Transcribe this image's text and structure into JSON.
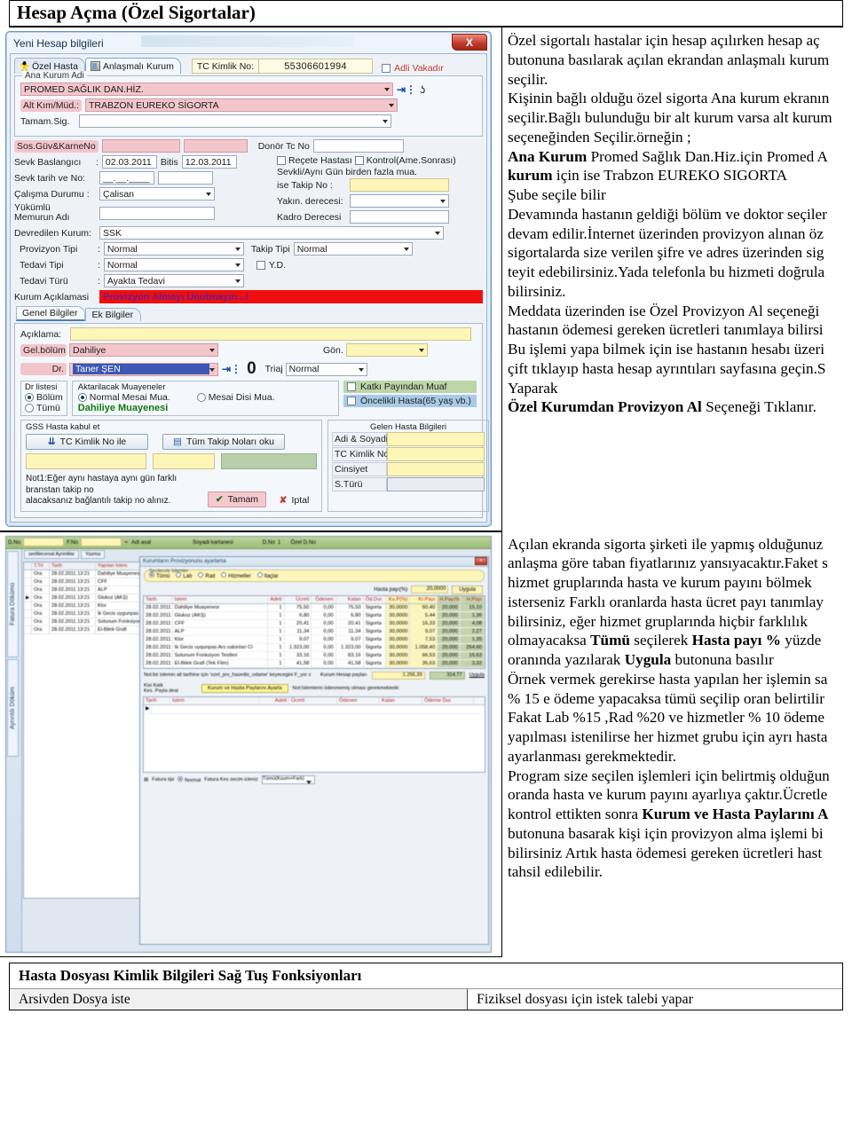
{
  "page": {
    "heading": "Hesap Açma (Özel Sigortalar)"
  },
  "dialog1": {
    "title": "Yeni Hesap bilgileri",
    "close_label": "X",
    "tabs": [
      {
        "label": "Özel Hasta",
        "icon": "person-icon",
        "active": false
      },
      {
        "label": "Anlaşmalı Kurum",
        "icon": "building-icon",
        "active": true
      }
    ],
    "tc_label": "TC Kimlik No:",
    "tc_value": "55306601994",
    "adli_label": "Adli Vakadır",
    "group_kurum": {
      "title": "Ana Kurum Adi",
      "ana_kurum_value": "PROMED SAĞLIK DAN.HİZ.",
      "alt_label": "Alt Kım/Müd.:",
      "alt_value": "TRABZON EUREKO SİGORTA",
      "tamam_label": "Tamam.Sig.",
      "tamam_value": ""
    },
    "sos_guv_label": "Sos.Güv&KarneNo",
    "donor_label": "Donör Tc No",
    "donor_value": "",
    "sevk_baslangici_label": "Sevk Baslangıcı",
    "sevk_baslangici_value": "02.03.2011",
    "bitis_label": "Bitis",
    "bitis_value": "12.03.2011",
    "recete_hastasi_label": "Reçete Hastası",
    "kontrol_label": "Kontrol(Ame.Sonrası)",
    "sevkli_note": "Sevkli/Aynı Gün birden fazla mua.",
    "ise_takip_label": "ise Takip No    :",
    "ise_takip_value": "",
    "sevk_tarih_label": "Sevk tarih ve No:",
    "sevk_tarih_value": "__.__.____",
    "calisma_label": "Çalışma Durumu :",
    "calisma_value": "Çalisan",
    "yakin_label": "Yakın. derecesi:",
    "yakin_value": "",
    "yukumlu_label": "Yükümlü\nMemurun Adı",
    "yukumlu_l1": "Yükümlü",
    "yukumlu_l2": "Memurun Adı",
    "yukumlu_value": "",
    "kadro_label": "Kadro Derecesi",
    "kadro_value": "",
    "devredilen_label": "Devredilen Kurum:",
    "devredilen_value": "SSK",
    "provizyon_tipi_label": "Provizyon Tipi",
    "provizyon_tipi_value": "Normal",
    "takip_tipi_label": "Takip Tipi",
    "takip_tipi_value": "Normal",
    "tedavi_tipi_label": "Tedavi Tipi",
    "tedavi_tipi_value": "Normal",
    "yd_label": "Y.D.",
    "tedavi_turu_label": "Tedavi Türü",
    "tedavi_turu_value": "Ayakta Tedavi",
    "kurum_aciklamasi_label": "Kurum Açıklamasi",
    "kurum_aciklamasi_value": "Provizyon Almayı Unutmayın...!",
    "subtabs": [
      {
        "label": "Genel Bilgiler",
        "active": true
      },
      {
        "label": "Ek Bilgiler",
        "active": false
      }
    ],
    "aciklama_label": "Açıklama:",
    "aciklama_value": "",
    "gel_bolum_label": "Gel.bölüm",
    "gel_bolum_value": "Dahiliye",
    "gon_label": "Gön.",
    "gon_value": "",
    "dr_label": "Dr.",
    "dr_value": "Taner ŞEN",
    "triaj_label": "Triaj",
    "triaj_value": "Normal",
    "counter_value": "0",
    "dr_listesi_title": "Dr listesi",
    "dr_listesi_options": [
      "Bölüm",
      "Tümü"
    ],
    "aktarilacak_title": "Aktarilacak Muayeneler",
    "normal_mesai_label": "Normal Mesai Mua.",
    "mesai_disi_label": "Mesai Disi Mua.",
    "dahiliye_muayenesi": "Dahiliye Muayenesi",
    "katki_label": "Katkı Payından Muaf",
    "oncelikli_label": "Öncelikli Hasta(65 yaş vb.)",
    "gss_title": "GSS Hasta kabul et",
    "tc_kimlik_btn": "TC Kimlik No ile",
    "tum_takip_btn": "Tüm Takip Noları oku",
    "gelen_hasta_title": "Gelen Hasta Bilgileri",
    "gelen_fields": [
      {
        "label": "Adi & Soyadi",
        "value": ""
      },
      {
        "label": "TC Kimlik No",
        "value": ""
      },
      {
        "label": "Cinsiyet",
        "value": ""
      },
      {
        "label": "S.Türü",
        "value": ""
      }
    ],
    "not1_l1": "Not1:Eğer aynı hastaya aynı gün farklı branstan takip no",
    "not1_l2": "alacaksanız bağlantılı takip no alınız.",
    "tamam_btn": "Tamam",
    "iptal_btn": "Iptal"
  },
  "text1": {
    "lines": [
      {
        "text": "Özel sigortalı hastalar için hesap açılırken hesap aç",
        "bold": false
      },
      {
        "text": "butonuna basılarak açılan ekrandan anlaşmalı kurum",
        "bold": false
      },
      {
        "text": "seçilir.",
        "bold": false
      },
      {
        "text": "Kişinin bağlı olduğu özel sigorta Ana kurum ekranın",
        "bold": false
      },
      {
        "text": "seçilir.Bağlı bulunduğu bir alt kurum varsa alt kurum",
        "bold": false
      },
      {
        "text": "seçeneğinden Seçilir.örneğin ;",
        "bold": false
      },
      {
        "text": "Ana Kurum  Promed Sağlık Dan.Hiz.için Promed A",
        "bold": "partial1"
      },
      {
        "text": "kurum için ise Trabzon EUREKO SIGORTA",
        "bold": "partial2"
      },
      {
        "text": " Şube  seçile bilir",
        "bold": false
      },
      {
        "text": "Devamında hastanın geldiği bölüm ve doktor seçiler",
        "bold": false
      },
      {
        "text": "devam edilir.İnternet üzerinden provizyon alınan öz",
        "bold": false
      },
      {
        "text": "sigortalarda size verilen şifre ve adres üzerinden sig",
        "bold": false
      },
      {
        "text": "teyit edebilirsiniz.Yada telefonla bu hizmeti doğrula",
        "bold": false
      },
      {
        "text": "bilirsiniz.",
        "bold": false
      },
      {
        "text": "Meddata üzerinden ise Özel Provizyon Al seçeneği",
        "bold": false
      },
      {
        "text": "hastanın ödemesi gereken ücretleri tanımlaya bilirsi",
        "bold": false
      },
      {
        "text": "Bu işlemi yapa bilmek için ise hastanın hesabı üzeri",
        "bold": false
      },
      {
        "text": "çift tıklayıp hasta hesap ayrıntıları sayfasına geçin.S",
        "bold": false
      },
      {
        "text": "Yaparak",
        "bold": false
      },
      {
        "text": "Özel Kurumdan Provizyon Al Seçeneği Tıklanır.",
        "bold": "partial3"
      }
    ],
    "l7_bold": "Ana Kurum",
    "l7_rest": " Promed Sağlık Dan.Hiz.için Promed A",
    "l8_bold": "kurum",
    "l8_rest": " için ise Trabzon EUREKO SIGORTA",
    "l20_bold": "Özel Kurumdan Provizyon Al",
    "l20_rest": " Seçeneği Tıklanır."
  },
  "dialog2": {
    "topbar_fields": [
      {
        "label": "D.No",
        "value": ""
      },
      {
        "label": "F.No",
        "value": ""
      },
      {
        "label": "Adi asal",
        "value": ""
      },
      {
        "label": "Soyadi kartanesi",
        "value": ""
      },
      {
        "label": "D.No",
        "value": "1"
      },
      {
        "label": "Özel D.No",
        "value": ""
      }
    ],
    "vertical_tabs": [
      "Fatura Dökümü",
      "Ayrıntılı Döküm"
    ],
    "left_tabs": [
      "serilliecenal Ayrintilar",
      "Yazma"
    ],
    "left_grid_headers": [
      "",
      "T.Tri",
      "Tarih",
      "Yapılan Islem"
    ],
    "left_grid_rows": [
      {
        "c0": "Ora",
        "c1": "28.02.2011 13:21",
        "c2": "Dahiliye Muayenesi"
      },
      {
        "c0": "Ora",
        "c1": "28.02.2011 13:21",
        "c2": "CFF"
      },
      {
        "c0": "Ora",
        "c1": "28.02.2011 13:21",
        "c2": "ALP"
      },
      {
        "c0": "Ora",
        "c1": "28.02.2011 13:21",
        "c2": "Glukoz (AKŞ)"
      },
      {
        "c0": "Ora",
        "c1": "28.02.2011 13:21",
        "c2": "Klor"
      },
      {
        "c0": "Ora",
        "c1": "28.02.2011 13:21",
        "c2": "Ik Gecis uygunpas"
      },
      {
        "c0": "Ora",
        "c1": "28.02.2011 13:21",
        "c2": "Solunum Fonksiyon"
      },
      {
        "c0": "Ora",
        "c1": "28.02.2011 13:21",
        "c2": "El-Bilek Grafi"
      }
    ],
    "inner_title": "Kurumların Provizyonunu ayarlama",
    "inner_close": "x",
    "secilecek_label": "Secilecek Islemler",
    "secilecek_options": [
      "Tümü",
      "Lab",
      "Rad",
      "Hizmetler",
      "Ilaçlar"
    ],
    "secilecek_selected": "Tümü",
    "hasta_payi_label": "Hasta payı(%)",
    "hasta_payi_value": "20,0000",
    "uygula_btn": "Uygula",
    "table_headers": [
      "Tarih",
      "Islem",
      "Adeti",
      "Ücreti",
      "Ödenen",
      "Kalan",
      "Öd.Dur.",
      "Ku.P(%)",
      "Kr.Payı",
      "H.Payı%",
      "H.Payı"
    ],
    "table_rows": [
      {
        "tarih": "28.02.2011",
        "islem": "Dahiliye Muayenesi",
        "adet": "1",
        "ucret": "75,50",
        "odenen": "0,00",
        "kalan": "75,50",
        "oddur": "Sigorta",
        "kup": "30,0000",
        "krpayi": "60,40",
        "hpyuzde": "20,000",
        "hpayi": "15,10"
      },
      {
        "tarih": "28.02.2011",
        "islem": "Glukoz (AKŞ)",
        "adet": "1",
        "ucret": "6,80",
        "odenen": "0,00",
        "kalan": "6,80",
        "oddur": "Sigorta",
        "kup": "30,0000",
        "krpayi": "5,44",
        "hpyuzde": "20,000",
        "hpayi": "1,36"
      },
      {
        "tarih": "28.02.2011",
        "islem": "CFF",
        "adet": "1",
        "ucret": "20,41",
        "odenen": "0,00",
        "kalan": "20,41",
        "oddur": "Sigorta",
        "kup": "30,0000",
        "krpayi": "16,33",
        "hpyuzde": "20,000",
        "hpayi": "4,08"
      },
      {
        "tarih": "28.02.2011",
        "islem": "ALP",
        "adet": "1",
        "ucret": "11,34",
        "odenen": "0,00",
        "kalan": "11,34",
        "oddur": "Sigorta",
        "kup": "30,0000",
        "krpayi": "9,07",
        "hpyuzde": "20,000",
        "hpayi": "2,27"
      },
      {
        "tarih": "28.02.2011",
        "islem": "Klor",
        "adet": "1",
        "ucret": "9,07",
        "odenen": "0,00",
        "kalan": "9,07",
        "oddur": "Sigorta",
        "kup": "30,0000",
        "krpayi": "7,53",
        "hpyuzde": "20,000",
        "hpayi": "1,35"
      },
      {
        "tarih": "28.02.2011",
        "islem": "Ik Gecis uyqunpas Ars salonlari Cl",
        "adet": "1",
        "ucret": "1.323,00",
        "odenen": "0,00",
        "kalan": "1.323,00",
        "oddur": "Sigorta",
        "kup": "30,0000",
        "krpayi": "1.058,40",
        "hpyuzde": "20,000",
        "hpayi": "264,60"
      },
      {
        "tarih": "28.02.2011",
        "islem": "Solunum Fonksiyon Testleri",
        "adet": "1",
        "ucret": "33,16",
        "odenen": "0,00",
        "kalan": "83,16",
        "oddur": "Sigorta",
        "kup": "30,0000",
        "krpayi": "66,53",
        "hpyuzde": "20,000",
        "hpayi": "16,63"
      },
      {
        "tarih": "28.02.2011",
        "islem": "El-Bilek Grafi (Tek Film)",
        "adet": "1",
        "ucret": "41,58",
        "odenen": "0,00",
        "kalan": "41,58",
        "oddur": "Sigorta",
        "kup": "30,0000",
        "krpayi": "36,63",
        "hpyuzde": "20,000",
        "hpayi": "3,32"
      }
    ],
    "note_text": "Not:bir islemin alt tarihine için 'ozel_prv_hasedis_odame' keyecegini F_yor z",
    "kurum_hesap_label": "Kurum Hesap payları",
    "kurum_hesap_v1": "1.255,39",
    "kurum_hesap_v2": "314,77",
    "kurum_uygula_btn": "Uygula",
    "kes_paylar_l1": "Kisi Katk",
    "kes_paylar_l2": "Kes. Payla  deai",
    "kurum_hasta_btn": "Kurum ve Hasta Paylarını Ayarla",
    "kurum_hasta_note": "Not:Islemlerin ödenmemiş olması gerekmektedir.",
    "bottom_headers": [
      "Tarih",
      "Islem",
      "Adeti",
      "Ücreti",
      "Ödenen",
      "Kalan",
      "Ödeme Dur."
    ],
    "bottom_left_label": "Fatura tipi",
    "bottom_left_opt": "Normal",
    "bottom_left_sel": "Fatura Kes secim icleniz",
    "bottom_left_sel2": "Tümü(Kuum+Fark)"
  },
  "text2": {
    "lines": [
      "Açılan ekranda sigorta şirketi ile yapmış olduğunuz",
      "anlaşma göre taban fiyatlarınız yansıyacaktır.Faket s",
      "hizmet gruplarında hasta ve kurum payını bölmek",
      "isterseniz Farklı oranlarda hasta ücret payı tanımlay",
      "bilirsiniz, eğer hizmet gruplarında hiçbir farklılık",
      "olmayacaksa  Tümü seçilerek Hasta payı %  yüzde",
      "oranında yazılarak Uygula butonuna basılır",
      "Örnek vermek gerekirse hasta yapılan her işlemin sa",
      "% 15 e ödeme yapacaksa tümü seçilip oran belirtilir",
      "Fakat Lab %15 ,Rad %20 ve hizmetler % 10 ödeme",
      "yapılması istenilirse her hizmet grubu için ayrı hasta",
      "ayarlanması gerekmektedir.",
      "Program size seçilen işlemleri için belirtmiş olduğun",
      "oranda hasta ve kurum payını ayarlıya çaktır.Ücretle",
      "kontrol ettikten sonra Kurum ve Hasta Paylarını A",
      "butonuna basarak kişi için provizyon alma işlemi bi",
      "bilirsiniz Artık hasta ödemesi gereken ücretleri hast",
      "tahsil edilebilir."
    ],
    "l6_a": "olmayacaksa  ",
    "l6_b": "Tümü",
    "l6_c": " seçilerek ",
    "l6_d": "Hasta payı %",
    "l6_e": "  yüzde",
    "l7_a": "oranında yazılarak ",
    "l7_b": "Uygula",
    "l7_c": " butonuna basılır",
    "l15_a": "kontrol ettikten sonra ",
    "l15_b": "Kurum ve Hasta Paylarını A",
    "l15_c": ""
  },
  "bottom": {
    "title": "Hasta Dosyası Kimlik Bilgileri  Sağ Tuş Fonksiyonları",
    "rows": [
      {
        "left": "Arsivden Dosya iste",
        "right": "Fiziksel dosyası için istek talebi yapar"
      }
    ]
  }
}
